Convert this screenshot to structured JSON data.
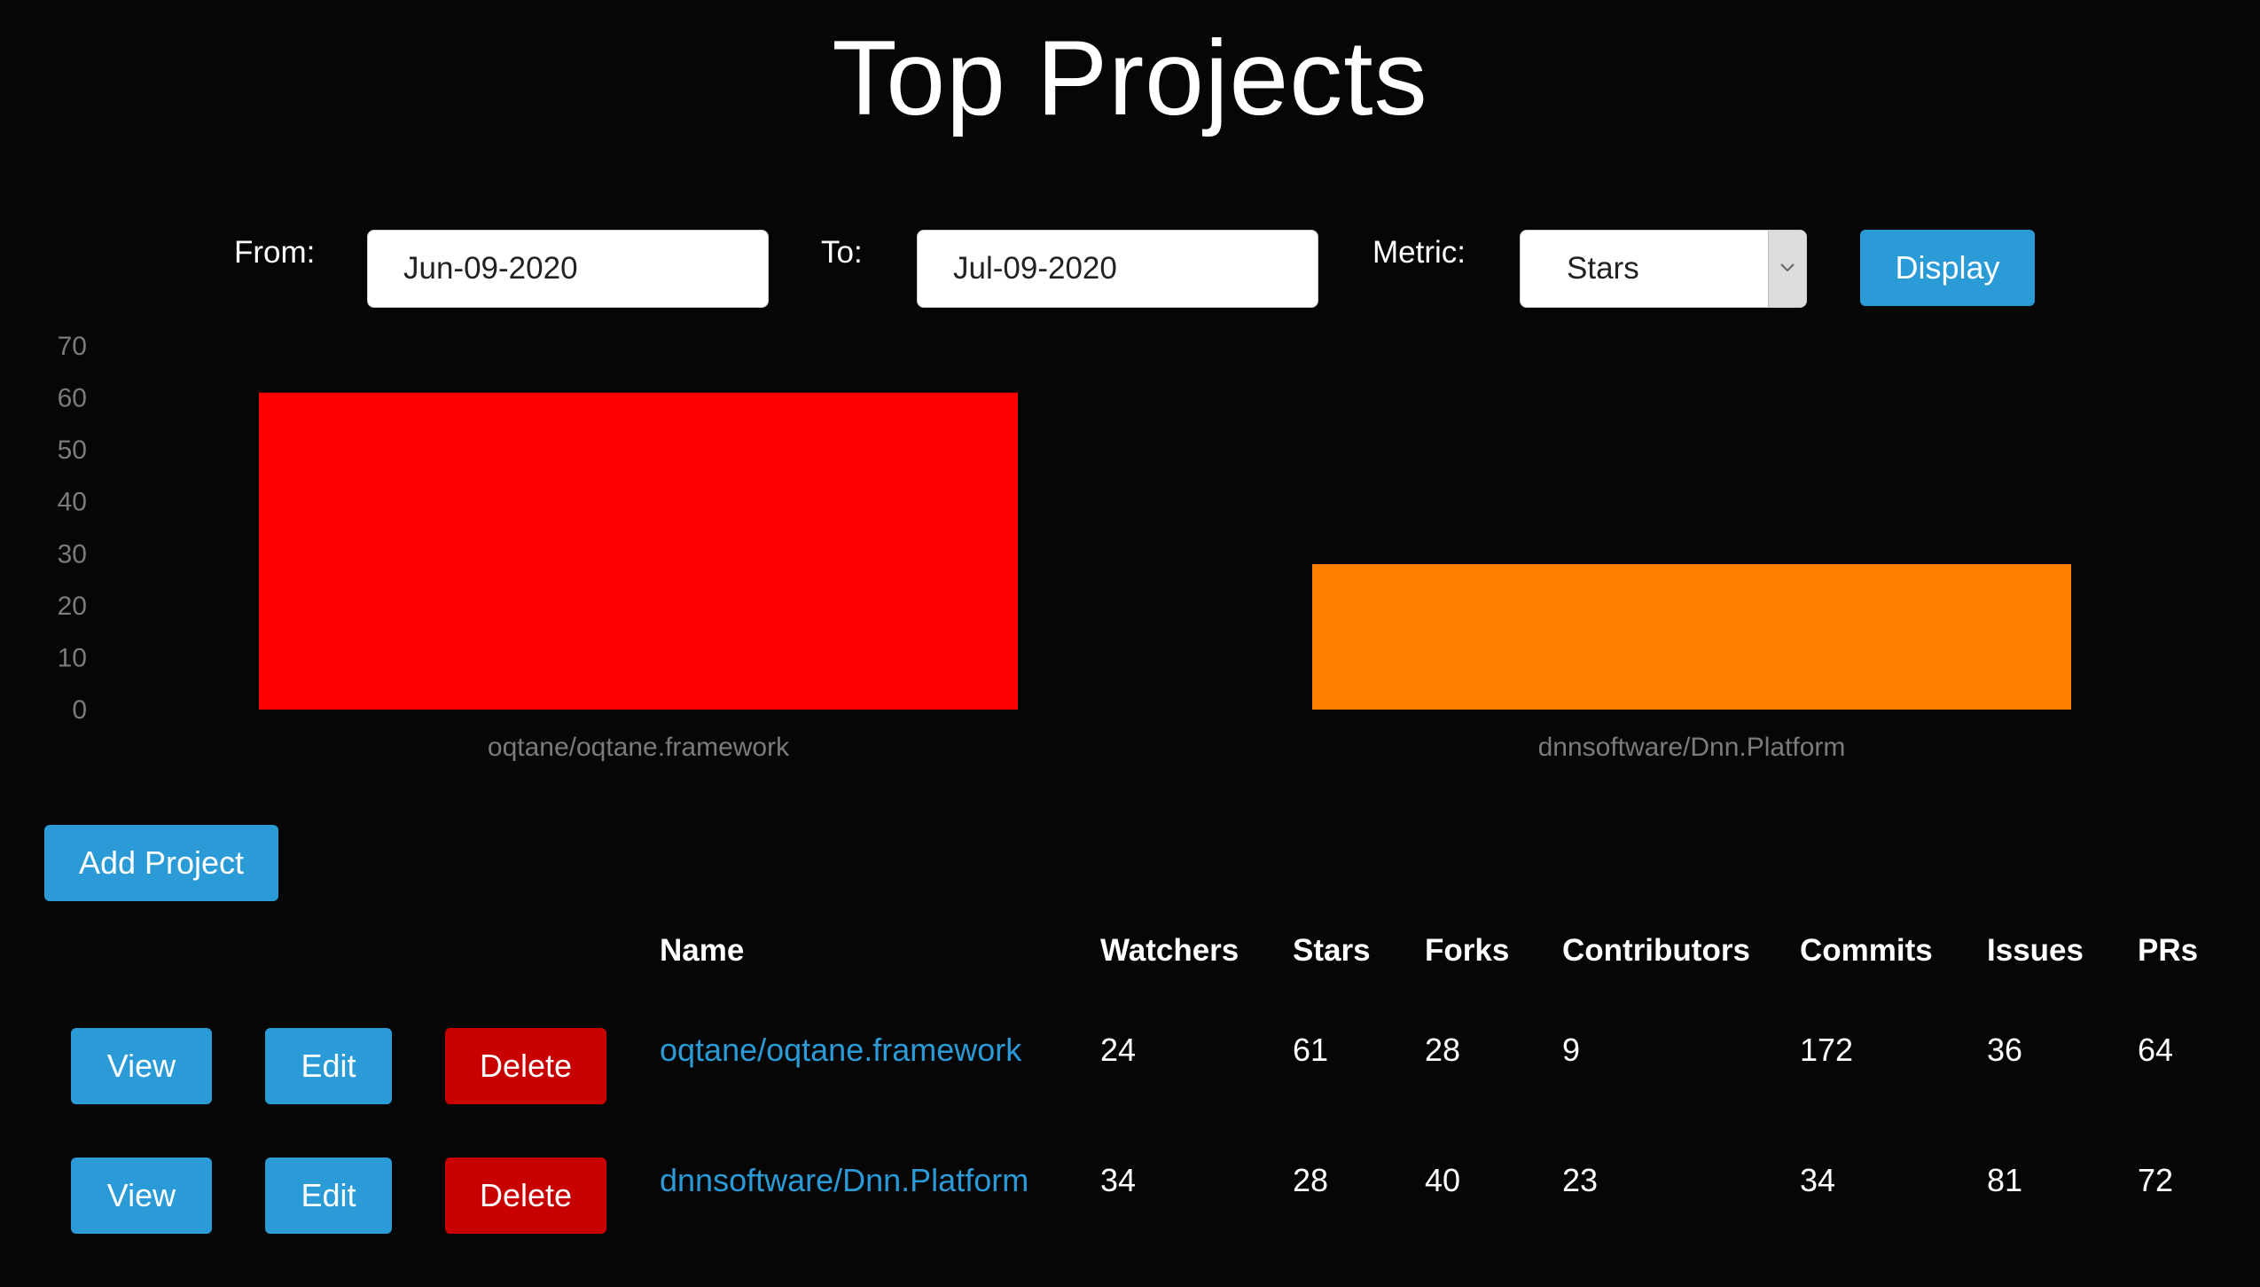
{
  "page": {
    "title": "Top Projects"
  },
  "filters": {
    "from_label": "From:",
    "from_value": "Jun-09-2020",
    "to_label": "To:",
    "to_value": "Jul-09-2020",
    "metric_label": "Metric:",
    "metric_value": "Stars",
    "display_label": "Display"
  },
  "chart_data": {
    "type": "bar",
    "categories": [
      "oqtane/oqtane.framework",
      "dnnsoftware/Dnn.Platform"
    ],
    "values": [
      61,
      28
    ],
    "colors": [
      "#ff0000",
      "#ff8000"
    ],
    "yticks": [
      "0",
      "10",
      "20",
      "30",
      "40",
      "50",
      "60",
      "70"
    ],
    "ylim": [
      0,
      70
    ],
    "grid": false,
    "legend": "none"
  },
  "actions": {
    "add_project_label": "Add Project"
  },
  "table": {
    "headers": [
      "Name",
      "Watchers",
      "Stars",
      "Forks",
      "Contributors",
      "Commits",
      "Issues",
      "PRs"
    ],
    "rows": [
      {
        "name": "oqtane/oqtane.framework",
        "cells": [
          "24",
          "61",
          "28",
          "9",
          "172",
          "36",
          "64"
        ],
        "view": "View",
        "edit": "Edit",
        "delete": "Delete"
      },
      {
        "name": "dnnsoftware/Dnn.Platform",
        "cells": [
          "34",
          "28",
          "40",
          "23",
          "34",
          "81",
          "72"
        ],
        "view": "View",
        "edit": "Edit",
        "delete": "Delete"
      }
    ]
  },
  "icons": {
    "select_arrow": "chevron-down-icon"
  }
}
